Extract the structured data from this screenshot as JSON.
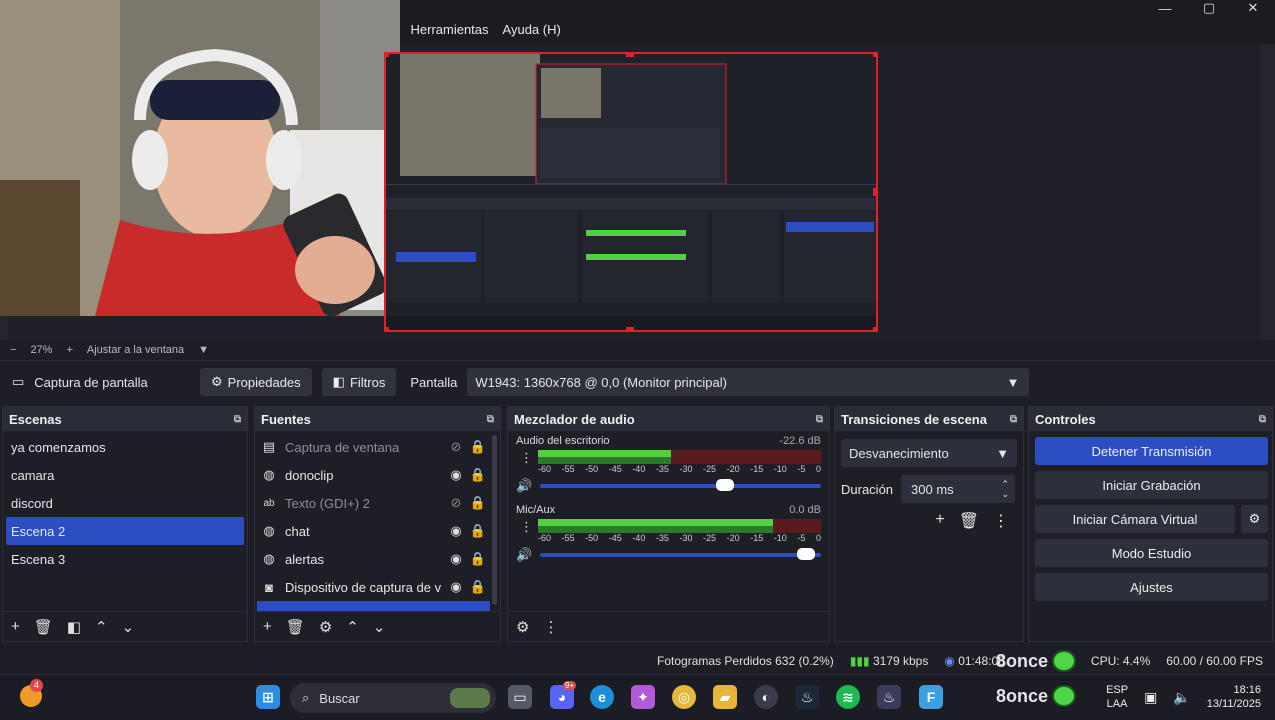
{
  "menu": {
    "partial": "s",
    "herramientas": "Herramientas",
    "ayuda": "Ayuda (H)"
  },
  "window_controls": {
    "minimize": "—",
    "maximize": "▢",
    "close": "✕"
  },
  "preview": {
    "zoom": "27%",
    "fit_label": "Ajustar a la ventana"
  },
  "source_toolbar": {
    "source_name": "Captura de pantalla",
    "properties": "Propiedades",
    "filters": "Filtros",
    "display_label": "Pantalla",
    "display_value": "W1943: 1360x768 @ 0,0 (Monitor principal)"
  },
  "scenes": {
    "title": "Escenas",
    "items": [
      "ya comenzamos",
      "camara",
      "discord",
      "Escena 2",
      "Escena 3"
    ],
    "active": "Escena 2"
  },
  "sources": {
    "title": "Fuentes",
    "items": [
      {
        "icon": "window-icon",
        "name": "Captura de ventana",
        "visible": false
      },
      {
        "icon": "globe-icon",
        "name": "donoclip",
        "visible": true
      },
      {
        "icon": "text-icon",
        "name": "Texto (GDI+) 2",
        "visible": false
      },
      {
        "icon": "globe-icon",
        "name": "chat",
        "visible": true
      },
      {
        "icon": "globe-icon",
        "name": "alertas",
        "visible": true
      },
      {
        "icon": "camera-icon",
        "name": "Dispositivo de captura de v",
        "visible": true
      }
    ]
  },
  "mixer": {
    "title": "Mezclador de audio",
    "channels": [
      {
        "name": "Audio del escritorio",
        "db": "-22.6 dB",
        "level": 0.47,
        "volume": 0.69
      },
      {
        "name": "Mic/Aux",
        "db": "0.0 dB",
        "level": 0.83,
        "volume": 0.98
      }
    ],
    "ticks": [
      "-60",
      "-55",
      "-50",
      "-45",
      "-40",
      "-35",
      "-30",
      "-25",
      "-20",
      "-15",
      "-10",
      "-5",
      "0"
    ]
  },
  "transitions": {
    "title": "Transiciones de escena",
    "selected": "Desvanecimiento",
    "duration_label": "Duración",
    "duration_value": "300 ms"
  },
  "controls": {
    "title": "Controles",
    "stop_stream": "Detener Transmisión",
    "start_recording": "Iniciar Grabación",
    "virtual_cam": "Iniciar Cámara Virtual",
    "studio_mode": "Modo Estudio",
    "settings": "Ajustes"
  },
  "status": {
    "dropped": "Fotogramas Perdidos 632 (0.2%)",
    "bitrate": "3179 kbps",
    "time": "01:48:08",
    "cpu": "CPU: 4.4%",
    "fps": "60.00 / 60.00 FPS"
  },
  "overlay_text": "8once",
  "taskbar": {
    "notification_count": "4",
    "search_placeholder": "Buscar",
    "lang_top": "ESP",
    "lang_bottom": "LAA",
    "time": "18:16",
    "date": "13/11/2025",
    "discord_badge": "9+"
  },
  "colors": {
    "accent": "#2d4ec2",
    "selection_border": "#e0202a",
    "meter_green": "#53d142",
    "bg": "#1e1f26"
  }
}
